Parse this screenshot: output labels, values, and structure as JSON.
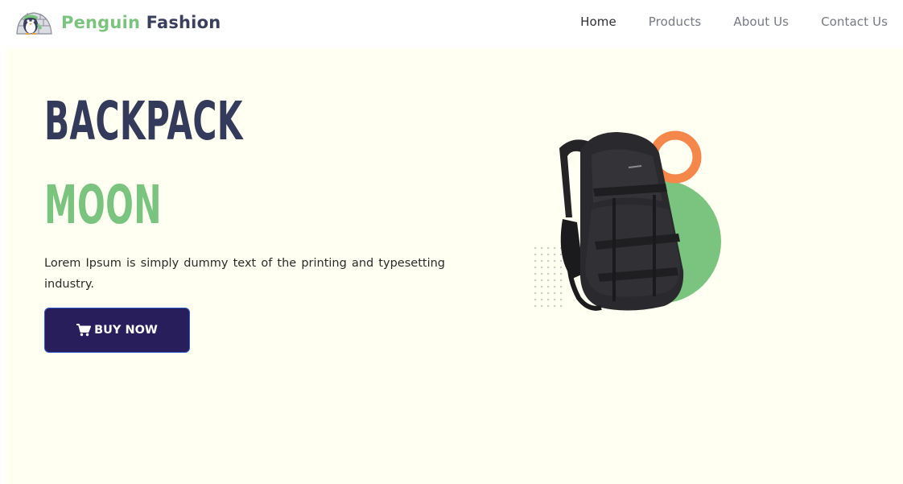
{
  "brand": {
    "name_part1": "Penguin",
    "name_part2": "Fashion",
    "icon": "penguin-igloo-logo",
    "colors": {
      "primary": "#7bc47f",
      "dark": "#3a3f5c"
    }
  },
  "nav": {
    "items": [
      {
        "label": "Home",
        "active": true
      },
      {
        "label": "Products",
        "active": false
      },
      {
        "label": "About Us",
        "active": false
      },
      {
        "label": "Contact Us",
        "active": false
      }
    ]
  },
  "hero": {
    "title_line1": "BACKPACK",
    "title_line2": "MOON",
    "description": "Lorem Ipsum is simply dummy text of the printing and typesetting industry.",
    "cta_label": "BUY NOW",
    "cta_icon": "shopping-cart-icon",
    "colors": {
      "background": "#fffff2",
      "title": "#343a5a",
      "accent": "#7bc47f",
      "button": "#291e5c",
      "ring": "#f5874a"
    }
  }
}
